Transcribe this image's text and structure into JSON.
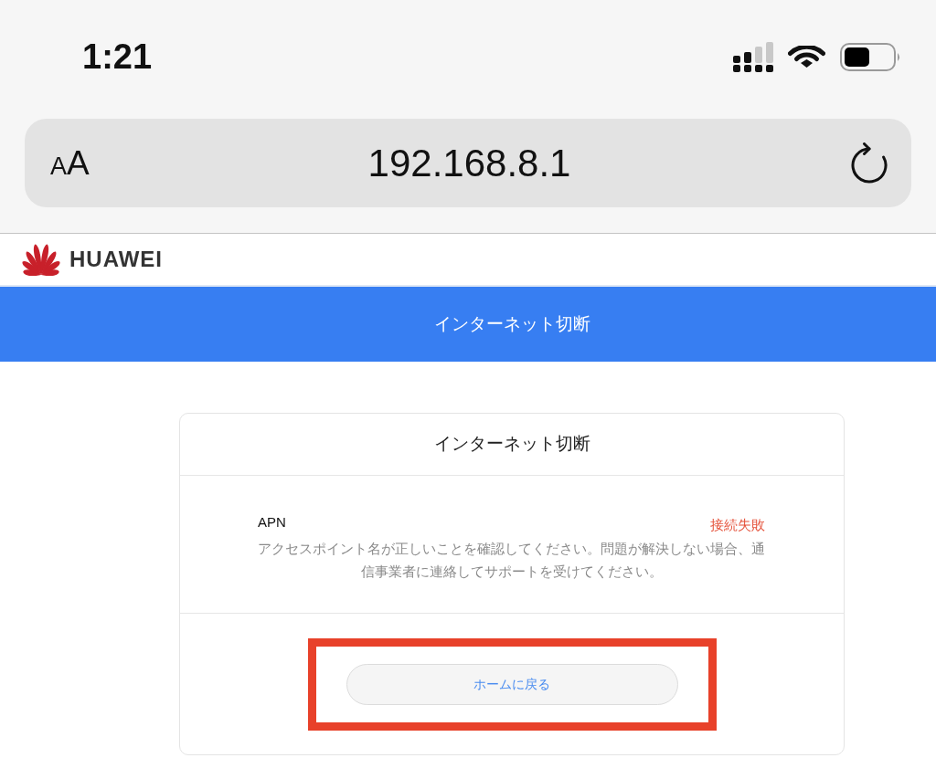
{
  "status_bar": {
    "time": "1:21"
  },
  "address_bar": {
    "text_size_button": "AA",
    "url": "192.168.8.1"
  },
  "site_header": {
    "logo_text": "HUAWEI"
  },
  "title_band": {
    "title": "インターネット切断"
  },
  "card": {
    "title": "インターネット切断",
    "connection": {
      "label": "APN",
      "status": "接続失敗",
      "message": "アクセスポイント名が正しいことを確認してください。問題が解決しない場合、通信事業者に連絡してサポートを受けてください。"
    },
    "button": {
      "label": "ホームに戻る",
      "highlighted": true
    }
  }
}
